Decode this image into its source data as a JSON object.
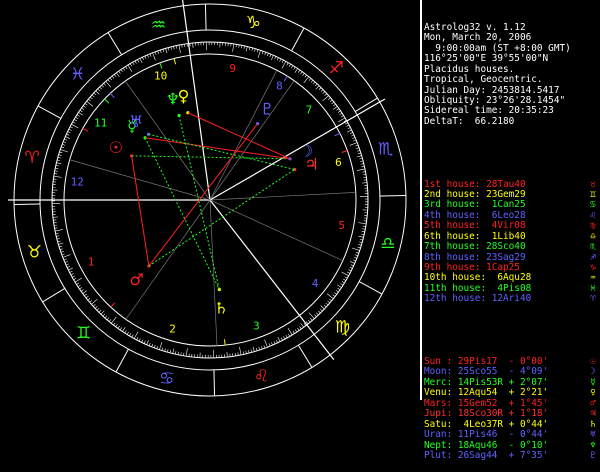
{
  "header": [
    "Astrolog32 v. 1.12",
    "Mon, March 20, 2006",
    "  9:00:00am (ST +8:00 GMT)",
    "116°25'00\"E 39°55'00\"N",
    "Placidus houses.",
    "Tropical, Geocentric.",
    "Julian Day: 2453814.5417",
    "Obliquity: 23°26'28.1454\"",
    "Sidereal time: 20:35:23",
    "DeltaT:  66.2180"
  ],
  "houses": [
    {
      "text": "1st house: 28Tau40",
      "glyph": "♉",
      "color": "#ff2020"
    },
    {
      "text": "2nd house: 23Gem29",
      "glyph": "♊",
      "color": "#ffff00"
    },
    {
      "text": "3rd house:  1Can25",
      "glyph": "♋",
      "color": "#20ff20"
    },
    {
      "text": "4th house:  6Leo28",
      "glyph": "♌",
      "color": "#6060ff"
    },
    {
      "text": "5th house:  4Vir08",
      "glyph": "♍",
      "color": "#ff2020"
    },
    {
      "text": "6th house:  1Lib40",
      "glyph": "♎",
      "color": "#ffff00"
    },
    {
      "text": "7th house: 28Sco40",
      "glyph": "♏",
      "color": "#20ff20"
    },
    {
      "text": "8th house: 23Sag29",
      "glyph": "♐",
      "color": "#6060ff"
    },
    {
      "text": "9th house: 1Cap25",
      "glyph": "♑",
      "color": "#ff2020"
    },
    {
      "text": "10th house:  6Aqu28",
      "glyph": "♒",
      "color": "#ffff00"
    },
    {
      "text": "11th house:  4Pis08",
      "glyph": "♓",
      "color": "#20ff20"
    },
    {
      "text": "12th house: 12Ari40",
      "glyph": "♈",
      "color": "#6060ff"
    }
  ],
  "planets": [
    {
      "text": "Sun : 29Pis17  - 0°00'",
      "glyph": "☉",
      "color": "#ff2020"
    },
    {
      "text": "Moon: 25Sco55  - 4°09'",
      "glyph": "☽",
      "color": "#6060ff"
    },
    {
      "text": "Merc: 14Pis53R + 2°07'",
      "glyph": "☿",
      "color": "#20ff20"
    },
    {
      "text": "Venu: 12Aqu54  + 2°21'",
      "glyph": "♀",
      "color": "#ffff00"
    },
    {
      "text": "Mars: 15Gem52  + 1°45'",
      "glyph": "♂",
      "color": "#ff2020"
    },
    {
      "text": "Jupi: 18Sco30R + 1°18'",
      "glyph": "♃",
      "color": "#ff3030"
    },
    {
      "text": "Satu:  4Leo37R + 0°44'",
      "glyph": "♄",
      "color": "#ffff00"
    },
    {
      "text": "Uran: 11Pis46  - 0°44'",
      "glyph": "♅",
      "color": "#6060ff"
    },
    {
      "text": "Nept: 18Aqu46  - 0°10'",
      "glyph": "♆",
      "color": "#20ff20"
    },
    {
      "text": "Plut: 26Sag44  + 7°35'",
      "glyph": "♇",
      "color": "#6060ff"
    }
  ],
  "wheel": {
    "signs": [
      "♈",
      "♉",
      "♊",
      "♋",
      "♌",
      "♍",
      "♎",
      "♏",
      "♐",
      "♑",
      "♒",
      "♓"
    ],
    "sign_colors": [
      "#ff2020",
      "#ffff00",
      "#20ff20",
      "#6060ff",
      "#ff2020",
      "#ffff00",
      "#20ff20",
      "#6060ff",
      "#ff2020",
      "#ffff00",
      "#20ff20",
      "#6060ff"
    ],
    "house_numbers": [
      "1",
      "2",
      "3",
      "4",
      "5",
      "6",
      "7",
      "8",
      "9",
      "10",
      "11",
      "12"
    ],
    "asc": 28.67,
    "cusps": [
      28.67,
      83.48,
      121.42,
      156.47,
      184.13,
      211.67,
      238.67,
      263.48,
      271.42,
      306.47,
      334.13,
      12.67
    ],
    "planet_longitudes": [
      359.28,
      235.92,
      344.88,
      312.9,
      75.87,
      228.5,
      124.62,
      341.77,
      318.77,
      266.73
    ],
    "aspects": [
      {
        "a": 0,
        "b": 1,
        "color": "#20ff20"
      },
      {
        "a": 0,
        "b": 4,
        "color": "#ff2020"
      },
      {
        "a": 2,
        "b": 1,
        "color": "#ff2020"
      },
      {
        "a": 2,
        "b": 6,
        "color": "#20ff20"
      },
      {
        "a": 3,
        "b": 1,
        "color": "#ff2020"
      },
      {
        "a": 4,
        "b": 9,
        "color": "#ff2020"
      },
      {
        "a": 7,
        "b": 5,
        "color": "#20ff20"
      },
      {
        "a": 8,
        "b": 6,
        "color": "#20ff20"
      },
      {
        "a": 4,
        "b": 5,
        "color": "#20ff20"
      }
    ]
  }
}
